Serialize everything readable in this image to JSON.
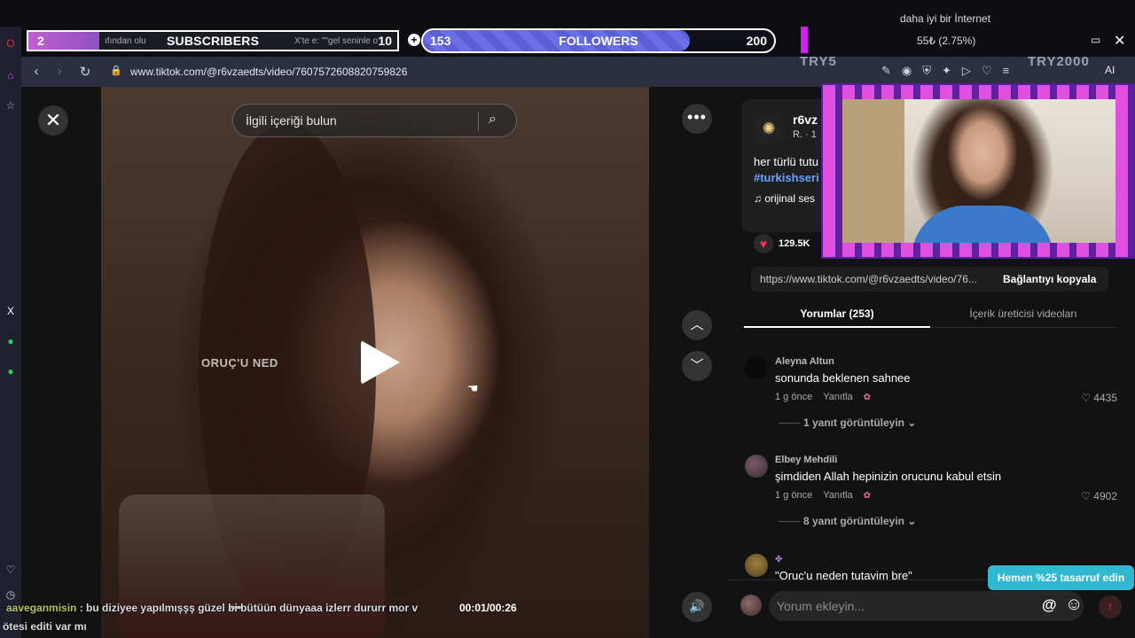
{
  "overlay": {
    "subscribers": {
      "current": "2",
      "label": "SUBSCRIBERS",
      "goal": "10"
    },
    "followers": {
      "current": "153",
      "label": "FOLLOWERS",
      "goal": "200",
      "progress_percent": 76
    },
    "ghost_tabs": [
      "ıfından olu",
      "X'te e: \"\"gel seninle o"
    ],
    "network_title": "daha iyi bir İnternet",
    "network_value": "55₺ (2.75%)",
    "try5": "TRY5",
    "try2000": "TRY2000",
    "accent_pink": "#d020f0",
    "accent_bar": "#5b5fd6"
  },
  "browser": {
    "url": "www.tiktok.com/@r6vzaedts/video/7607572608820759826",
    "ai_label": "AI"
  },
  "video": {
    "search_placeholder": "İlgili içeriği bulun",
    "caption": "ORUÇ'U NED",
    "time": "00:01/00:26"
  },
  "chat": {
    "user": "aaveganmisin",
    "message": ": bu diziyee yapılmışşş güzel bi bütüün dünyaaa izlerr dururr mor v",
    "line2": "ötesi editi var mı"
  },
  "panel": {
    "author_name": "r6vz",
    "author_sub": "R. · 1",
    "description": "her türlü tutu",
    "hashtag": "#turkishseri",
    "music": "orijinal ses",
    "like_count": "129.5K",
    "link_url": "https://www.tiktok.com/@r6vzaedts/video/76...",
    "copy_label": "Bağlantıyı kopyala",
    "tab_comments": "Yorumlar (253)",
    "tab_creator": "İçerik üreticisi videoları",
    "comments": [
      {
        "user": "Aleyna Altun",
        "text": "sonunda beklenen sahnee",
        "time": "1 g önce",
        "reply": "Yanıtla",
        "likes": "4435",
        "replies": "1 yanıt görüntüleyin"
      },
      {
        "user": "Elbey Mehdili",
        "text": "şimdiden Allah hepinizin orucunu kabul etsin",
        "time": "1 g önce",
        "reply": "Yanıtla",
        "likes": "4902",
        "replies": "8 yanıt görüntüleyin"
      },
      {
        "user": "",
        "text": "\"Oruc'u neden tutayim bre\""
      }
    ],
    "save_banner": "Hemen %25 tasarruf edin",
    "comment_placeholder": "Yorum ekleyin..."
  }
}
